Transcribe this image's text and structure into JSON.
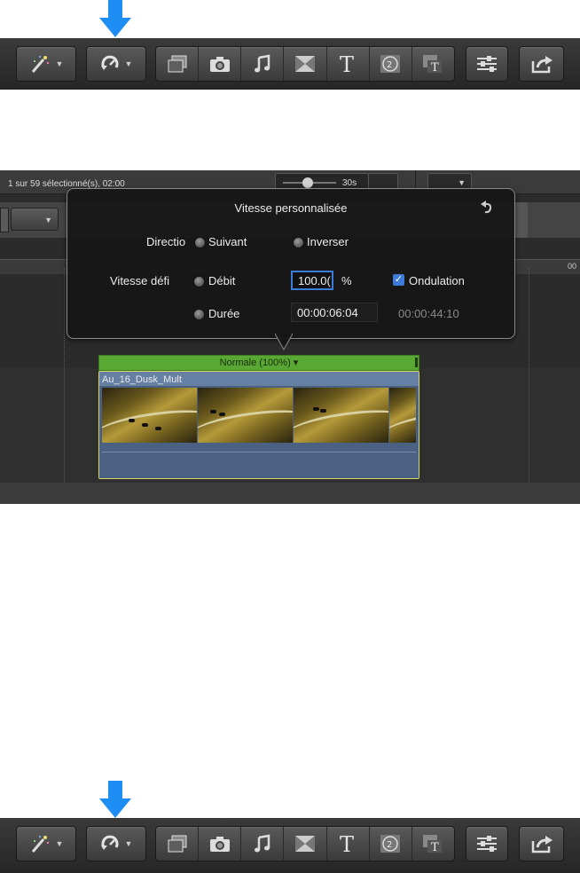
{
  "toolbar_icons": {
    "magic": "magic-wand-icon",
    "retime": "retime-speedometer-icon",
    "group": [
      "photo-browser-icon",
      "camera-icon",
      "music-note-icon",
      "transitions-icon",
      "text-title-icon",
      "generator-icon",
      "theme-icon"
    ],
    "inspector": "sliders-icon",
    "share": "share-icon"
  },
  "colors": {
    "arrow": "#1e8ef5",
    "clip_speedbar": "#5aa834",
    "clip_border": "#d8d86a",
    "checkbox": "#3d7bd8"
  },
  "timeline": {
    "status": "1 sur 59 sélectionné(s), 02:00",
    "zoom_value": "30s",
    "ruler_end": "00"
  },
  "popover": {
    "title": "Vitesse personnalisée",
    "direction_label": "Directio",
    "direction_forward": "Suivant",
    "direction_reverse": "Inverser",
    "speed_label": "Vitesse défi",
    "rate_option": "Débit",
    "rate_value": "100.0(",
    "rate_unit": "%",
    "ripple_label": "Ondulation",
    "ripple_checked": true,
    "duration_option": "Durée",
    "duration_value": "00:00:06:04",
    "total_duration": "00:00:44:10"
  },
  "clip": {
    "speed_bar": "Normale (100%) ▾",
    "name": "Au_16_Dusk_Mult"
  }
}
